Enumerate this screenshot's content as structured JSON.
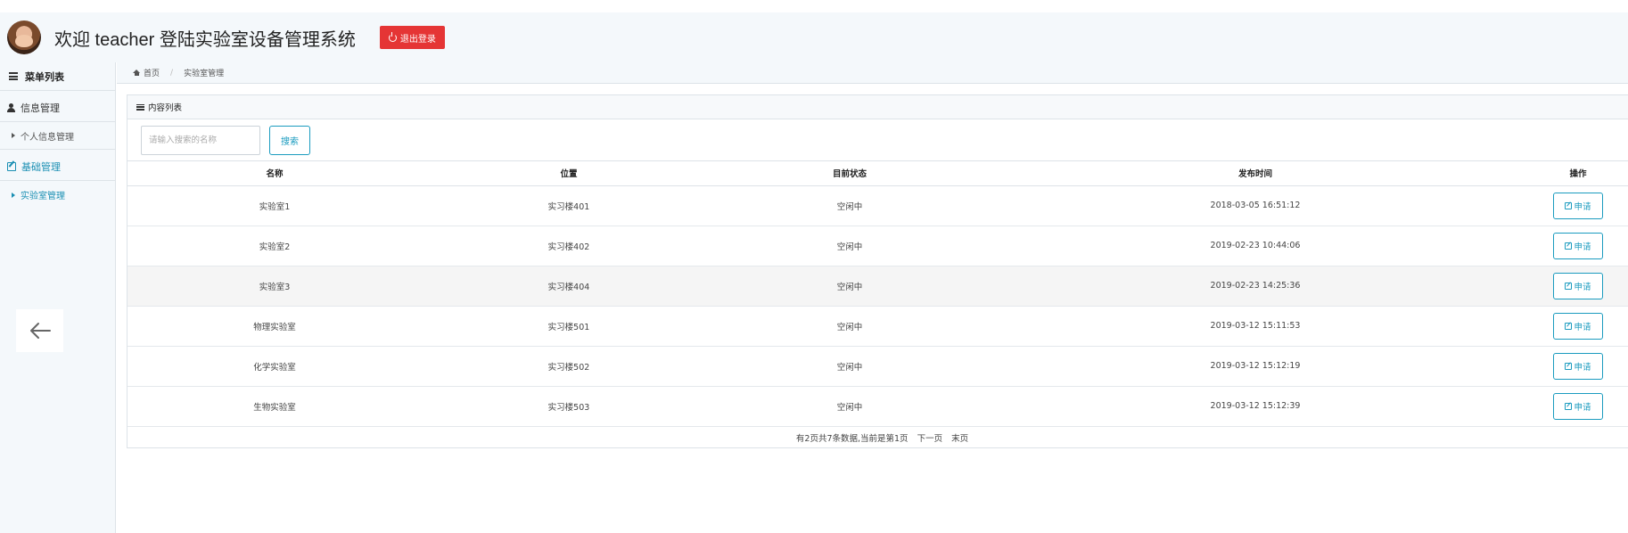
{
  "header": {
    "welcome_text": "欢迎 teacher 登陆实验室设备管理系统",
    "logout_label": "退出登录"
  },
  "sidebar": {
    "menu_title": "菜单列表",
    "groups": [
      {
        "label": "信息管理",
        "items": [
          "个人信息管理"
        ]
      },
      {
        "label": "基础管理",
        "items": [
          "实验室管理"
        ]
      }
    ]
  },
  "breadcrumb": {
    "home": "首页",
    "current": "实验室管理"
  },
  "panel": {
    "title": "内容列表",
    "search_placeholder": "请输入搜索的名称",
    "search_label": "搜索"
  },
  "table": {
    "headers": [
      "名称",
      "位置",
      "目前状态",
      "发布时间",
      "操作"
    ],
    "action_label": "申请",
    "rows": [
      [
        "实验室1",
        "实习楼401",
        "空闲中",
        "2018-03-05 16:51:12"
      ],
      [
        "实验室2",
        "实习楼402",
        "空闲中",
        "2019-02-23 10:44:06"
      ],
      [
        "实验室3",
        "实习楼404",
        "空闲中",
        "2019-02-23 14:25:36"
      ],
      [
        "物理实验室",
        "实习楼501",
        "空闲中",
        "2019-03-12 15:11:53"
      ],
      [
        "化学实验室",
        "实习楼502",
        "空闲中",
        "2019-03-12 15:12:19"
      ],
      [
        "生物实验室",
        "实习楼503",
        "空闲中",
        "2019-03-12 15:12:39"
      ]
    ]
  },
  "pager": {
    "summary": "有2页共7条数据,当前是第1页",
    "next": "下一页",
    "last": "末页"
  },
  "colors": {
    "accent": "#1a9bbf",
    "logout": "#e53535",
    "sidebar_bg": "#f4f8fb"
  },
  "icons": [
    "avatar",
    "power-icon",
    "list-icon",
    "user-icon",
    "edit-icon",
    "caret-right-icon",
    "home-icon",
    "bars-icon",
    "arrow-left-icon"
  ]
}
